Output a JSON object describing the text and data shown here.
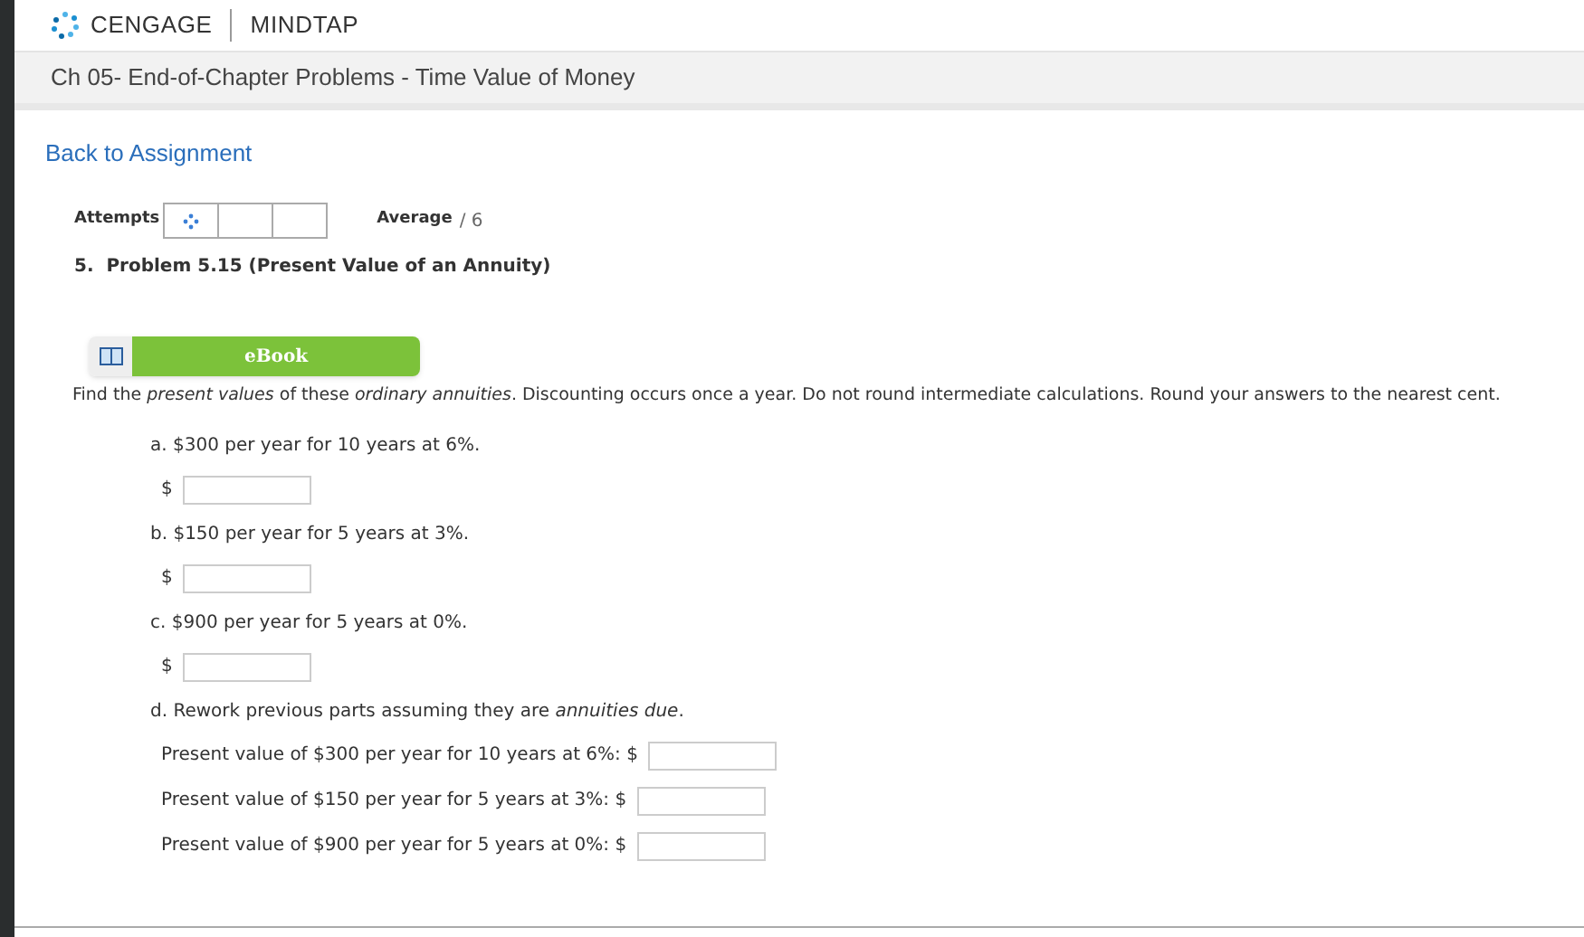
{
  "brand": {
    "company": "CENGAGE",
    "product": "MINDTAP"
  },
  "page_title": "Ch 05- End-of-Chapter Problems - Time Value of Money",
  "back_link": "Back to Assignment",
  "attempts": {
    "label": "Attempts",
    "average_label": "Average",
    "average_value": "/ 6"
  },
  "problem_title": "5.  Problem 5.15 (Present Value of an Annuity)",
  "ebook_button": "eBook",
  "instructions": "Find the *present values* of these *ordinary annuities*. Discounting occurs once a year. Do not round intermediate calculations. Round your answers to the nearest cent.",
  "parts": [
    {
      "prompt": "a. $300 per year for 10 years at 6%.",
      "fields": [
        {
          "label": "$"
        }
      ]
    },
    {
      "prompt": "b. $150 per year for 5 years at 3%.",
      "fields": [
        {
          "label": "$"
        }
      ]
    },
    {
      "prompt": "c. $900 per year for 5 years at 0%.",
      "fields": [
        {
          "label": "$"
        }
      ]
    },
    {
      "prompt": "d. Rework previous parts assuming they are *annuities due*.",
      "fields": [
        {
          "label": "Present value of $300 per year for 10 years at 6%: $"
        },
        {
          "label": "Present value of $150 per year for 5 years at 3%: $"
        },
        {
          "label": "Present value of $900 per year for 5 years at 0%: $"
        }
      ]
    }
  ]
}
